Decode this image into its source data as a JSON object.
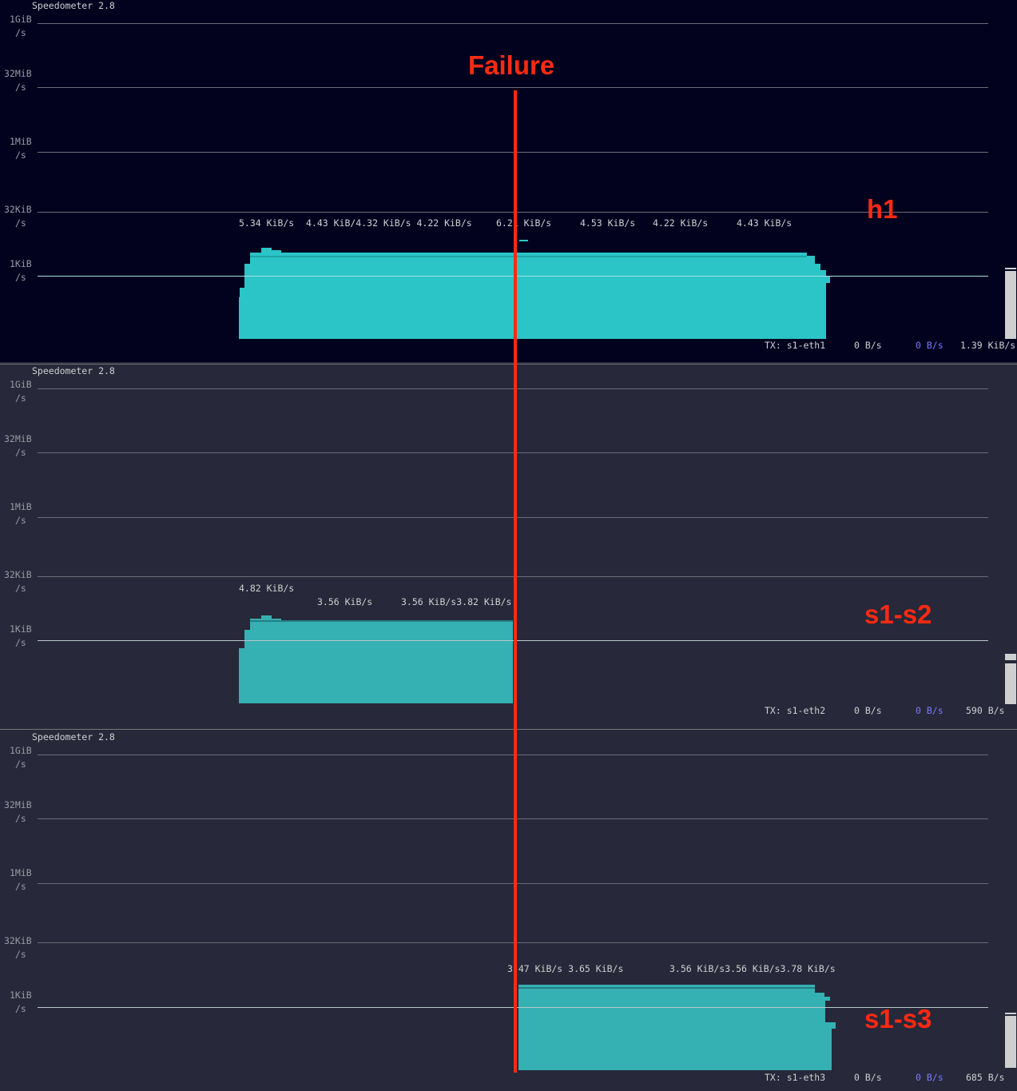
{
  "colors": {
    "panel_active_bg": "#02021f",
    "panel_bg": "#272839",
    "fill_active": "#2bc5c8",
    "fill": "#35b0b3",
    "annotation": "#ff2a12",
    "rx_accent": "#7a7aff"
  },
  "axis_labels": [
    [
      "1GiB",
      "/s"
    ],
    [
      "32MiB",
      "/s"
    ],
    [
      "1MiB",
      "/s"
    ],
    [
      "32KiB",
      "/s"
    ],
    [
      "1KiB",
      "/s"
    ]
  ],
  "annotation_failure": "Failure",
  "panels": [
    {
      "title": "Speedometer 2.8",
      "label": "h1",
      "rates": [
        "5.34 KiB/s",
        "4.43 KiB/4.32 KiB/s 4.22 KiB/s",
        "6.21 KiB/s",
        "4.53 KiB/s",
        "4.22 KiB/s",
        "4.43 KiB/s"
      ],
      "status": {
        "iface": "TX: s1-eth1",
        "current": "0 B/s",
        "rx": "0 B/s",
        "avg": "1.39 KiB/s"
      }
    },
    {
      "title": "Speedometer 2.8",
      "label": "s1-s2",
      "rates": [
        "4.82 KiB/s",
        "3.56 KiB/s",
        "3.56 KiB/s3.82 KiB/s"
      ],
      "status": {
        "iface": "TX: s1-eth2",
        "current": "0 B/s",
        "rx": "0 B/s",
        "avg": "590 B/s"
      }
    },
    {
      "title": "Speedometer 2.8",
      "label": "s1-s3",
      "rates": [
        "3.47 KiB/s 3.65 KiB/s",
        "3.56 KiB/s3.56 KiB/s3.78 KiB/s"
      ],
      "status": {
        "iface": "TX: s1-eth3",
        "current": "0 B/s",
        "rx": "0 B/s",
        "avg": "685 B/s"
      }
    }
  ]
}
